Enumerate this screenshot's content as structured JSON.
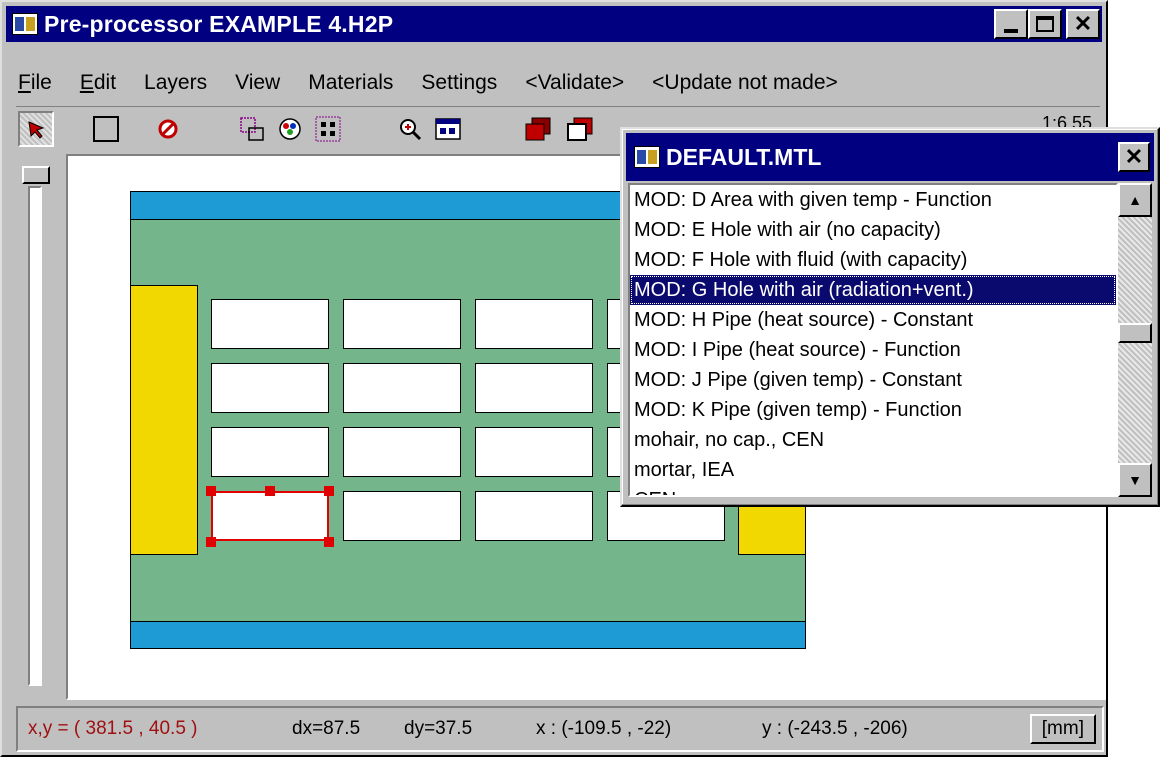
{
  "window": {
    "title": "Pre-processor  EXAMPLE 4.H2P",
    "min_label": "_",
    "close_label": "✕"
  },
  "menu": {
    "items": [
      {
        "label": "File"
      },
      {
        "label": "Edit"
      },
      {
        "label": "Layers"
      },
      {
        "label": "View"
      },
      {
        "label": "Materials"
      },
      {
        "label": "Settings"
      },
      {
        "label": "<Validate>"
      },
      {
        "label": "<Update not made>"
      }
    ]
  },
  "toolbar": {
    "tools": [
      "select-arrow-icon",
      "rectangle-icon",
      "no-entry-icon",
      "copy-shape-icon",
      "palette-icon",
      "grid-points-icon",
      "zoom-icon",
      "window-view-icon",
      "layer-front-icon",
      "layer-back-icon"
    ],
    "zoom_label": "1:6.55"
  },
  "status": {
    "xy": "x,y = ( 381.5 ,  40.5 )",
    "dx": "dx=87.5",
    "dy": "dy=37.5",
    "x": "x : (-109.5 ,  -22)",
    "y": "y : (-243.5 ,  -206)",
    "unit": "[mm]"
  },
  "materials_window": {
    "title": "DEFAULT.MTL",
    "close_label": "✕",
    "items": [
      "MOD: D Area with given temp - Function",
      "MOD: E Hole with air (no capacity)",
      "MOD: F Hole with fluid (with capacity)",
      "MOD: G Hole with air (radiation+vent.)",
      "MOD: H Pipe (heat source) - Constant",
      "MOD: I Pipe (heat source) - Function",
      "MOD: J Pipe (given temp) - Constant",
      "MOD: K Pipe (given temp) - Function",
      "mohair, no cap., CEN",
      "mortar, IEA",
      "                    CEN"
    ],
    "selected_index": 3
  },
  "colors": {
    "title_bar": "#000080",
    "concrete_green": "#74b58c",
    "insulation_blue": "#1e9ad4",
    "edge_yellow": "#f0d800",
    "selection_red": "#e00000"
  }
}
